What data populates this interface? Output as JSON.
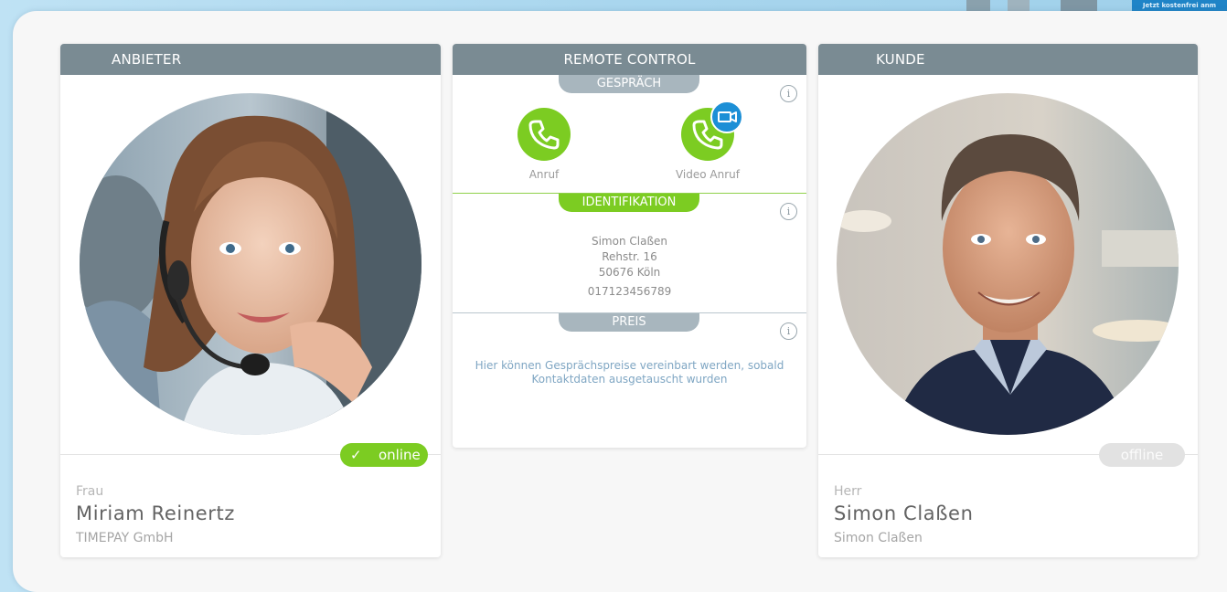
{
  "top_banner": {
    "label": "Jetzt kostenfrei anm"
  },
  "provider": {
    "header": "ANBIETER",
    "status": "online",
    "salutation": "Frau",
    "name": "Miriam Reinertz",
    "company": "TIMEPAY GmbH"
  },
  "remote_control": {
    "header": "REMOTE CONTROL",
    "call_section": {
      "title": "GESPRÄCH",
      "call_label": "Anruf",
      "video_call_label": "Video Anruf"
    },
    "identification": {
      "title": "IDENTIFIKATION",
      "name": "Simon Claßen",
      "street": "Rehstr. 16",
      "city": "50676 Köln",
      "phone": "017123456789"
    },
    "price": {
      "title": "PREIS",
      "description_line1": "Hier können Gesprächspreise vereinbart werden, sobald",
      "description_line2": "Kontaktdaten ausgetauscht wurden"
    }
  },
  "customer": {
    "header": "KUNDE",
    "status": "offline",
    "salutation": "Herr",
    "name": "Simon Claßen",
    "company": "Simon Claßen"
  },
  "colors": {
    "accent_green": "#7ccc22",
    "header_gray": "#7a8b93",
    "video_blue": "#1c8fd6"
  }
}
